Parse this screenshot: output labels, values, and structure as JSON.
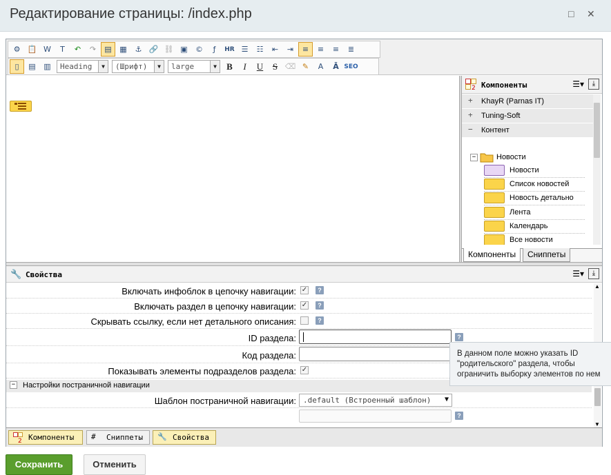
{
  "window": {
    "title": "Редактирование страницы: /index.php",
    "maximize_icon": "□",
    "close_icon": "✕"
  },
  "toolbar": {
    "style_select": "Heading",
    "font_select": "(Шрифт)",
    "size_select": "large",
    "bold": "B",
    "italic": "I",
    "underline": "U",
    "strike": "S",
    "hr": "HR",
    "seo": "SEO"
  },
  "components_panel": {
    "title": "Компоненты",
    "groups": [
      {
        "sign": "+",
        "label": "KhayR (Parnas IT)"
      },
      {
        "sign": "+",
        "label": "Tuning-Soft"
      },
      {
        "sign": "−",
        "label": "Контент"
      }
    ],
    "folder": {
      "sign": "−",
      "label": "Новости"
    },
    "items": [
      {
        "label": "Новости"
      },
      {
        "label": "Список новостей"
      },
      {
        "label": "Новость детально"
      },
      {
        "label": "Лента"
      },
      {
        "label": "Календарь"
      },
      {
        "label": "Все новости"
      }
    ],
    "tabs": [
      "Компоненты",
      "Сниппеты"
    ]
  },
  "properties_panel": {
    "title": "Свойства",
    "rows": [
      {
        "label": "Включать инфоблок в цепочку навигации:",
        "checked": true
      },
      {
        "label": "Включать раздел в цепочку навигации:",
        "checked": true
      },
      {
        "label": "Скрывать ссылку, если нет детального описания:",
        "checked": false
      }
    ],
    "section_id_label": "ID раздела:",
    "section_id_value": "",
    "section_code_label": "Код раздела:",
    "section_code_value": "",
    "show_sub_label": "Показывать элементы подразделов раздела:",
    "show_sub_checked": true,
    "pagination_section": "Настройки постраничной навигации",
    "pagination_template_label": "Шаблон постраничной навигации:",
    "pagination_template_value": ".default (Встроенный шаблон)",
    "qmark": "?",
    "check": "✓"
  },
  "tooltip": {
    "line1": "В данном поле можно указать ID",
    "line2": "\"родительского\" раздела, чтобы",
    "line3": "ограничить выборку элементов по нем"
  },
  "bottom_tabs": [
    "Компоненты",
    "Сниппеты",
    "Свойства"
  ],
  "buttons": {
    "save": "Сохранить",
    "cancel": "Отменить"
  },
  "colors": {
    "accent_save": "#5a9e2d",
    "component_yellow": "#fbd44a",
    "title_bar": "#e6edf0"
  }
}
